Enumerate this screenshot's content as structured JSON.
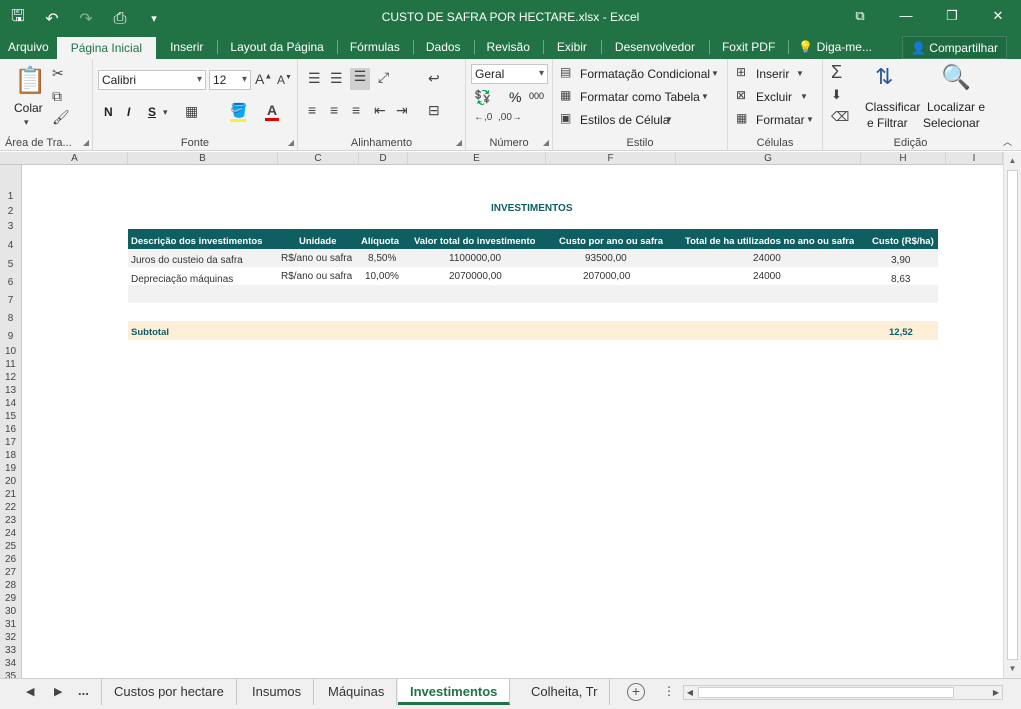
{
  "window": {
    "title": "CUSTO DE SAFRA POR HECTARE.xlsx - Excel"
  },
  "ribbon_tabs": [
    {
      "label": "Arquivo"
    },
    {
      "label": "Página Inicial"
    },
    {
      "label": "Inserir"
    },
    {
      "label": "Layout da Página"
    },
    {
      "label": "Fórmulas"
    },
    {
      "label": "Dados"
    },
    {
      "label": "Revisão"
    },
    {
      "label": "Exibir"
    },
    {
      "label": "Desenvolvedor"
    },
    {
      "label": "Foxit PDF"
    },
    {
      "label": "Diga-me..."
    }
  ],
  "share_label": "Compartilhar",
  "ribbon": {
    "clipboard": {
      "label": "Área de Tra...",
      "paste": "Colar"
    },
    "font": {
      "label": "Fonte",
      "name": "Calibri",
      "size": "12",
      "bold": "N",
      "italic": "I",
      "underline": "S"
    },
    "alignment": {
      "label": "Alinhamento"
    },
    "number": {
      "label": "Número",
      "format": "Geral",
      "percent": "%",
      "thousands": "000"
    },
    "styles": {
      "label": "Estilo",
      "conditional": "Formatação Condicional",
      "table": "Formatar como Tabela",
      "cell": "Estilos de Célula"
    },
    "cells": {
      "label": "Células",
      "insert": "Inserir",
      "delete": "Excluir",
      "format": "Formatar"
    },
    "editing": {
      "label": "Edição",
      "sort1": "Classificar",
      "sort2": "e Filtrar",
      "find1": "Localizar e",
      "find2": "Selecionar"
    }
  },
  "columns": [
    "A",
    "B",
    "C",
    "D",
    "E",
    "F",
    "G",
    "H",
    "I"
  ],
  "rows": [
    "1",
    "2",
    "3",
    "4",
    "5",
    "6",
    "7",
    "8",
    "9",
    "10",
    "11",
    "12",
    "13",
    "14",
    "15",
    "16",
    "17",
    "18",
    "19",
    "20",
    "21",
    "22",
    "23",
    "24",
    "25",
    "26",
    "27",
    "28",
    "29",
    "30",
    "31",
    "32",
    "33",
    "34",
    "35"
  ],
  "sheet": {
    "title": "INVESTIMENTOS",
    "headers": [
      "Descrição dos investimentos",
      "Unidade",
      "Alíquota",
      "Valor total do investimento",
      "Custo por ano ou safra",
      "Total de ha utilizados no ano ou safra",
      "Custo (R$/ha)"
    ],
    "data_rows": [
      [
        "Juros do custeio da safra",
        "R$/ano ou safra",
        "8,50%",
        "1100000,00",
        "93500,00",
        "24000",
        "3,90"
      ],
      [
        "Depreciação máquinas",
        "R$/ano ou safra",
        "10,00%",
        "2070000,00",
        "207000,00",
        "24000",
        "8,63"
      ]
    ],
    "subtotal_label": "Subtotal",
    "subtotal_value": "12,52"
  },
  "sheet_tabs": {
    "ellipsis": "...",
    "items": [
      "Custos por hectare",
      "Insumos",
      "Máquinas",
      "Investimentos",
      "Colheita, Tr"
    ],
    "active": "Investimentos"
  },
  "colors": {
    "accent": "#217346",
    "table_header": "#0f5e61",
    "subtotal_bg": "#fdefd7"
  }
}
